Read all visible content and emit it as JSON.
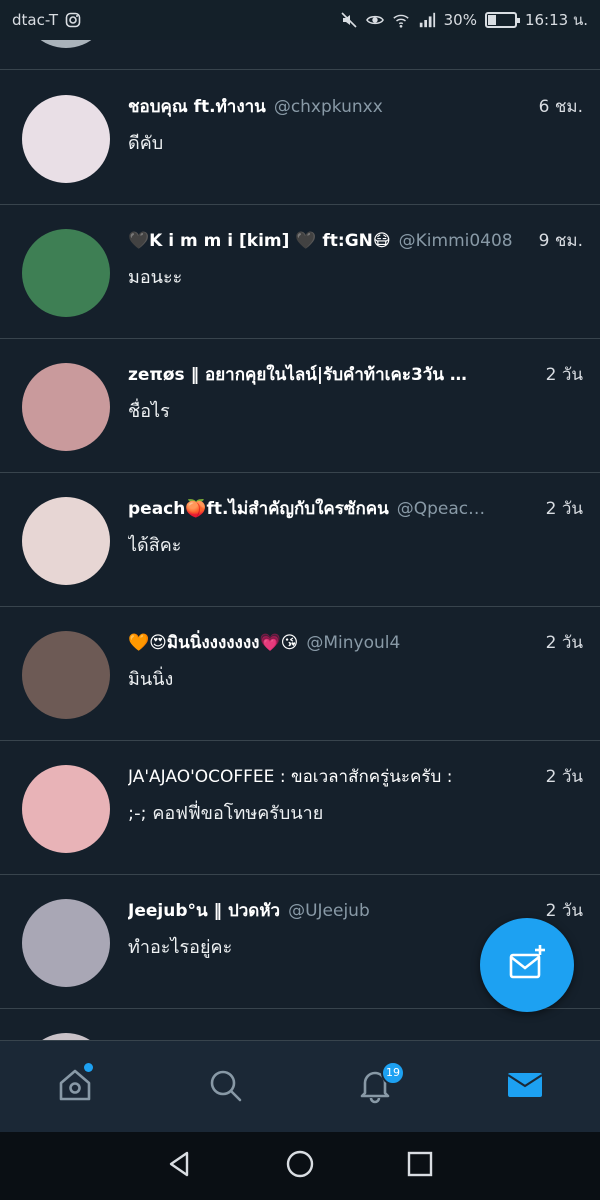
{
  "status_bar": {
    "carrier": "dtac-T",
    "battery": "30%",
    "battery_level": 0.3,
    "time": "16:13 น."
  },
  "conversations": [
    {
      "name": "ชอบคุณ ft.ทำงาน",
      "handle": "@chxpkunxx",
      "time": "6 ชม.",
      "message": "ดีคับ",
      "avatar_color": "#e9dfe6"
    },
    {
      "name": "🖤K i m m i [kim] 🖤 ft:GN😷",
      "handle": "@Kimmi0408",
      "time": "9 ชม.",
      "message": "มอนะะ",
      "avatar_color": "#3e7f54"
    },
    {
      "name": "zeπøs ‖ อยากคุยในไลน์|รับคำท้าเคะ3วัน …",
      "handle": "",
      "time": "2 วัน",
      "message": "ชื่อไร",
      "avatar_color": "#c99a9c"
    },
    {
      "name": "peach🍑ft.ไม่สำคัญกับใครซักคน",
      "handle": "@Qpeac…",
      "time": "2 วัน",
      "message": "ได้สิคะ",
      "avatar_color": "#e7d6d4"
    },
    {
      "name": "🧡😍มินนิ่งงงงงงง💗😘",
      "handle": "@Minyoul4",
      "time": "2 วัน",
      "message": "มินนิ่ง",
      "avatar_color": "#6d5a55"
    },
    {
      "name": "JA'AJAO'OCOFFEE : ขอเวลาสักครู่นะครับ :",
      "handle": "",
      "time": "2 วัน",
      "message": ";-; คอฟฟี่ขอโทษครับนาย",
      "avatar_color": "#e8b3b7"
    },
    {
      "name": "Jeejub°น ‖ ปวดหัว",
      "handle": "@UJeejub",
      "time": "2 วัน",
      "message": "ทำอะไรอยู่คะ",
      "avatar_color": "#a9a7b5"
    }
  ],
  "tabs": {
    "notifications_badge": "19"
  },
  "colors": {
    "background": "#15202b",
    "accent": "#1da1f2",
    "divider": "#38444d"
  }
}
